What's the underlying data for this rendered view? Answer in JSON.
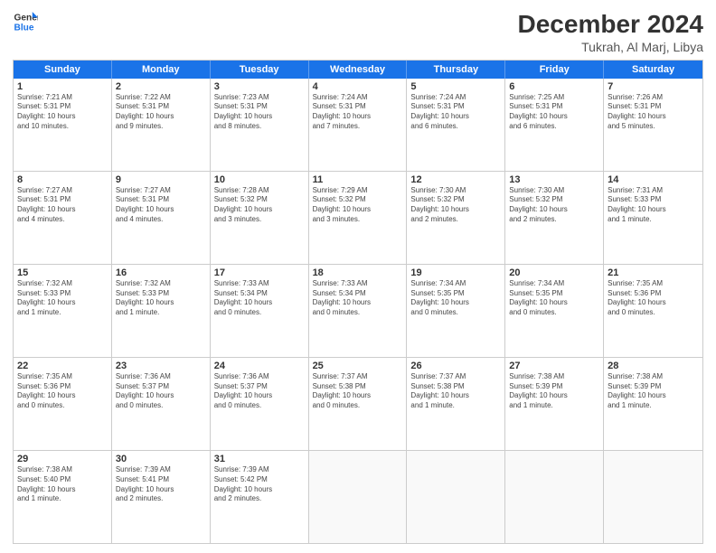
{
  "header": {
    "logo_general": "General",
    "logo_blue": "Blue",
    "month_year": "December 2024",
    "location": "Tukrah, Al Marj, Libya"
  },
  "weekdays": [
    "Sunday",
    "Monday",
    "Tuesday",
    "Wednesday",
    "Thursday",
    "Friday",
    "Saturday"
  ],
  "rows": [
    [
      {
        "day": "1",
        "lines": [
          "Sunrise: 7:21 AM",
          "Sunset: 5:31 PM",
          "Daylight: 10 hours",
          "and 10 minutes."
        ]
      },
      {
        "day": "2",
        "lines": [
          "Sunrise: 7:22 AM",
          "Sunset: 5:31 PM",
          "Daylight: 10 hours",
          "and 9 minutes."
        ]
      },
      {
        "day": "3",
        "lines": [
          "Sunrise: 7:23 AM",
          "Sunset: 5:31 PM",
          "Daylight: 10 hours",
          "and 8 minutes."
        ]
      },
      {
        "day": "4",
        "lines": [
          "Sunrise: 7:24 AM",
          "Sunset: 5:31 PM",
          "Daylight: 10 hours",
          "and 7 minutes."
        ]
      },
      {
        "day": "5",
        "lines": [
          "Sunrise: 7:24 AM",
          "Sunset: 5:31 PM",
          "Daylight: 10 hours",
          "and 6 minutes."
        ]
      },
      {
        "day": "6",
        "lines": [
          "Sunrise: 7:25 AM",
          "Sunset: 5:31 PM",
          "Daylight: 10 hours",
          "and 6 minutes."
        ]
      },
      {
        "day": "7",
        "lines": [
          "Sunrise: 7:26 AM",
          "Sunset: 5:31 PM",
          "Daylight: 10 hours",
          "and 5 minutes."
        ]
      }
    ],
    [
      {
        "day": "8",
        "lines": [
          "Sunrise: 7:27 AM",
          "Sunset: 5:31 PM",
          "Daylight: 10 hours",
          "and 4 minutes."
        ]
      },
      {
        "day": "9",
        "lines": [
          "Sunrise: 7:27 AM",
          "Sunset: 5:31 PM",
          "Daylight: 10 hours",
          "and 4 minutes."
        ]
      },
      {
        "day": "10",
        "lines": [
          "Sunrise: 7:28 AM",
          "Sunset: 5:32 PM",
          "Daylight: 10 hours",
          "and 3 minutes."
        ]
      },
      {
        "day": "11",
        "lines": [
          "Sunrise: 7:29 AM",
          "Sunset: 5:32 PM",
          "Daylight: 10 hours",
          "and 3 minutes."
        ]
      },
      {
        "day": "12",
        "lines": [
          "Sunrise: 7:30 AM",
          "Sunset: 5:32 PM",
          "Daylight: 10 hours",
          "and 2 minutes."
        ]
      },
      {
        "day": "13",
        "lines": [
          "Sunrise: 7:30 AM",
          "Sunset: 5:32 PM",
          "Daylight: 10 hours",
          "and 2 minutes."
        ]
      },
      {
        "day": "14",
        "lines": [
          "Sunrise: 7:31 AM",
          "Sunset: 5:33 PM",
          "Daylight: 10 hours",
          "and 1 minute."
        ]
      }
    ],
    [
      {
        "day": "15",
        "lines": [
          "Sunrise: 7:32 AM",
          "Sunset: 5:33 PM",
          "Daylight: 10 hours",
          "and 1 minute."
        ]
      },
      {
        "day": "16",
        "lines": [
          "Sunrise: 7:32 AM",
          "Sunset: 5:33 PM",
          "Daylight: 10 hours",
          "and 1 minute."
        ]
      },
      {
        "day": "17",
        "lines": [
          "Sunrise: 7:33 AM",
          "Sunset: 5:34 PM",
          "Daylight: 10 hours",
          "and 0 minutes."
        ]
      },
      {
        "day": "18",
        "lines": [
          "Sunrise: 7:33 AM",
          "Sunset: 5:34 PM",
          "Daylight: 10 hours",
          "and 0 minutes."
        ]
      },
      {
        "day": "19",
        "lines": [
          "Sunrise: 7:34 AM",
          "Sunset: 5:35 PM",
          "Daylight: 10 hours",
          "and 0 minutes."
        ]
      },
      {
        "day": "20",
        "lines": [
          "Sunrise: 7:34 AM",
          "Sunset: 5:35 PM",
          "Daylight: 10 hours",
          "and 0 minutes."
        ]
      },
      {
        "day": "21",
        "lines": [
          "Sunrise: 7:35 AM",
          "Sunset: 5:36 PM",
          "Daylight: 10 hours",
          "and 0 minutes."
        ]
      }
    ],
    [
      {
        "day": "22",
        "lines": [
          "Sunrise: 7:35 AM",
          "Sunset: 5:36 PM",
          "Daylight: 10 hours",
          "and 0 minutes."
        ]
      },
      {
        "day": "23",
        "lines": [
          "Sunrise: 7:36 AM",
          "Sunset: 5:37 PM",
          "Daylight: 10 hours",
          "and 0 minutes."
        ]
      },
      {
        "day": "24",
        "lines": [
          "Sunrise: 7:36 AM",
          "Sunset: 5:37 PM",
          "Daylight: 10 hours",
          "and 0 minutes."
        ]
      },
      {
        "day": "25",
        "lines": [
          "Sunrise: 7:37 AM",
          "Sunset: 5:38 PM",
          "Daylight: 10 hours",
          "and 0 minutes."
        ]
      },
      {
        "day": "26",
        "lines": [
          "Sunrise: 7:37 AM",
          "Sunset: 5:38 PM",
          "Daylight: 10 hours",
          "and 1 minute."
        ]
      },
      {
        "day": "27",
        "lines": [
          "Sunrise: 7:38 AM",
          "Sunset: 5:39 PM",
          "Daylight: 10 hours",
          "and 1 minute."
        ]
      },
      {
        "day": "28",
        "lines": [
          "Sunrise: 7:38 AM",
          "Sunset: 5:39 PM",
          "Daylight: 10 hours",
          "and 1 minute."
        ]
      }
    ],
    [
      {
        "day": "29",
        "lines": [
          "Sunrise: 7:38 AM",
          "Sunset: 5:40 PM",
          "Daylight: 10 hours",
          "and 1 minute."
        ]
      },
      {
        "day": "30",
        "lines": [
          "Sunrise: 7:39 AM",
          "Sunset: 5:41 PM",
          "Daylight: 10 hours",
          "and 2 minutes."
        ]
      },
      {
        "day": "31",
        "lines": [
          "Sunrise: 7:39 AM",
          "Sunset: 5:42 PM",
          "Daylight: 10 hours",
          "and 2 minutes."
        ]
      },
      {
        "day": "",
        "lines": []
      },
      {
        "day": "",
        "lines": []
      },
      {
        "day": "",
        "lines": []
      },
      {
        "day": "",
        "lines": []
      }
    ]
  ]
}
